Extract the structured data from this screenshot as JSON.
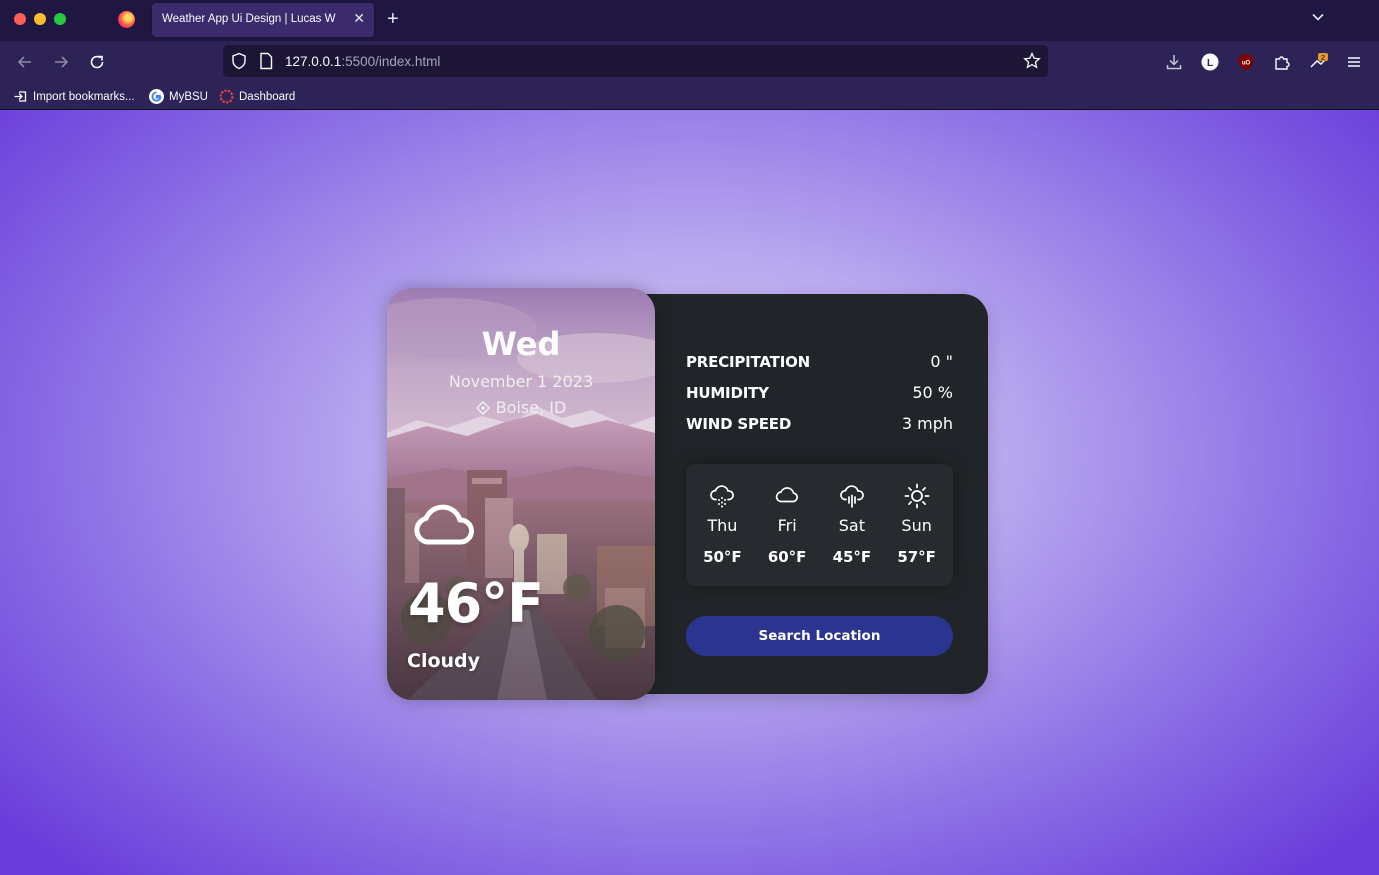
{
  "browser": {
    "tab_title": "Weather App Ui Design | Lucas W",
    "url_host": "127.0.0.1",
    "url_rest": ":5500/index.html",
    "bookmarks": [
      "Import bookmarks...",
      "MyBSU",
      "Dashboard"
    ],
    "extension_badge": "2",
    "profile_initial": "L"
  },
  "weather": {
    "day": "Wed",
    "date": "November 1 2023",
    "location": "Boise, ID",
    "temperature": "46°F",
    "description": "Cloudy",
    "icon": "cloud-icon"
  },
  "stats": [
    {
      "label": "PRECIPITATION",
      "value": "0 \""
    },
    {
      "label": "HUMIDITY",
      "value": "50 %"
    },
    {
      "label": "WIND SPEED",
      "value": "3 mph"
    }
  ],
  "forecast": [
    {
      "day": "Thu",
      "temp": "50°F",
      "icon": "cloud-snow-icon"
    },
    {
      "day": "Fri",
      "temp": "60°F",
      "icon": "cloud-icon"
    },
    {
      "day": "Sat",
      "temp": "45°F",
      "icon": "cloud-rain-icon"
    },
    {
      "day": "Sun",
      "temp": "57°F",
      "icon": "sun-icon"
    }
  ],
  "search_button": "Search Location",
  "colors": {
    "panel": "#212529",
    "button": "#2b3590",
    "accent_gradient_center": "#d9d2f7",
    "accent_gradient_edge": "#6a3ddb"
  }
}
